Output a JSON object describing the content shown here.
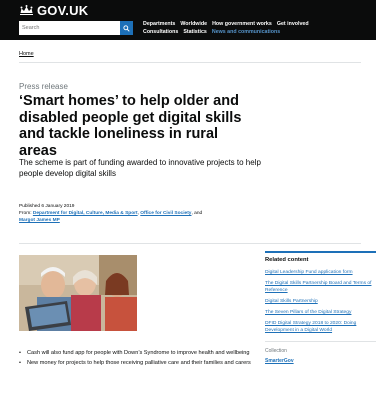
{
  "header": {
    "logo_text": "GOV.UK",
    "search_placeholder": "Search",
    "nav_row1": [
      "Departments",
      "Worldwide",
      "How government works",
      "Get involved"
    ],
    "nav_row2": [
      "Consultations",
      "Statistics",
      "News and communications"
    ]
  },
  "breadcrumb": "Home",
  "article": {
    "kicker": "Press release",
    "title": "‘Smart homes’ to help older and disabled people get digital skills and tackle loneliness in rural areas",
    "lede": "The scheme is part of funding awarded to innovative projects to help people develop digital skills",
    "published": "Published 6 January 2019",
    "from_label": "From:",
    "from_orgs": [
      "Department for Digital, Culture, Media & Sport",
      "Office for Civil Society",
      "Margot James MP"
    ],
    "from_and": "and",
    "bullets": [
      "Cash will also fund app for people with Down’s Syndrome to improve health and wellbeing",
      "New money for projects to help those receiving palliative care and their families and carers"
    ]
  },
  "related": {
    "title": "Related content",
    "links": [
      "Digital Leadership Fund application form",
      "The Digital Skills Partnership Board and Terms of Reference",
      "Digital Skills Partnership",
      "The Seven Pillars of the Digital Strategy",
      "DFID Digital Strategy 2018 to 2020: Doing Development in a Digital World"
    ],
    "collection_label": "Collection",
    "collection_link": "SmarterGov"
  },
  "colors": {
    "header_bg": "#0b0c0c",
    "link": "#1d70b8",
    "active_nav": "#5694ca",
    "secondary_text": "#6f777b"
  }
}
